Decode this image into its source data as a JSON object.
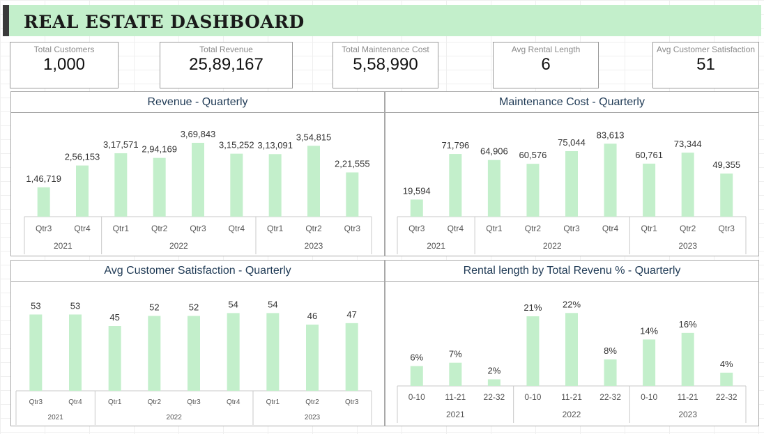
{
  "title": "REAL ESTATE DASHBOARD",
  "colors": {
    "bar": "#c3efcb",
    "title_bg": "#c3efcb",
    "axis": "#c8c8c8"
  },
  "kpis": [
    {
      "label": "Total Customers",
      "value": "1,000"
    },
    {
      "label": "Total Revenue",
      "value": "25,89,167"
    },
    {
      "label": "Total Maintenance Cost",
      "value": "5,58,990"
    },
    {
      "label": "Avg Rental Length",
      "value": "6"
    },
    {
      "label": "Avg Customer Satisfaction",
      "value": "51"
    }
  ],
  "chart_data": [
    {
      "type": "bar",
      "title": "Revenue - Quarterly",
      "categories": [
        "Qtr3",
        "Qtr4",
        "Qtr1",
        "Qtr2",
        "Qtr3",
        "Qtr4",
        "Qtr1",
        "Qtr2",
        "Qtr3"
      ],
      "groups": [
        {
          "label": "2021",
          "count": 2
        },
        {
          "label": "2022",
          "count": 4
        },
        {
          "label": "2023",
          "count": 3
        }
      ],
      "values": [
        146719,
        256153,
        317571,
        294169,
        369843,
        315252,
        313091,
        354815,
        221555
      ],
      "data_labels": [
        "1,46,719",
        "2,56,153",
        "3,17,571",
        "2,94,169",
        "3,69,843",
        "3,15,252",
        "3,13,091",
        "3,54,815",
        "2,21,555"
      ],
      "ylim": [
        0,
        450000
      ],
      "grid": false
    },
    {
      "type": "bar",
      "title": "Maintenance Cost - Quarterly",
      "categories": [
        "Qtr3",
        "Qtr4",
        "Qtr1",
        "Qtr2",
        "Qtr3",
        "Qtr4",
        "Qtr1",
        "Qtr2",
        "Qtr3"
      ],
      "groups": [
        {
          "label": "2021",
          "count": 2
        },
        {
          "label": "2022",
          "count": 4
        },
        {
          "label": "2023",
          "count": 3
        }
      ],
      "values": [
        19594,
        71796,
        64906,
        60576,
        75044,
        83613,
        60761,
        73344,
        49355
      ],
      "data_labels": [
        "19,594",
        "71,796",
        "64,906",
        "60,576",
        "75,044",
        "83,613",
        "60,761",
        "73,344",
        "49,355"
      ],
      "ylim": [
        0,
        95000
      ],
      "grid": false
    },
    {
      "type": "bar",
      "title": "Avg Customer Satisfaction - Quarterly",
      "categories": [
        "Qtr3",
        "Qtr4",
        "Qtr1",
        "Qtr2",
        "Qtr3",
        "Qtr4",
        "Qtr1",
        "Qtr2",
        "Qtr3"
      ],
      "groups": [
        {
          "label": "2021",
          "count": 2
        },
        {
          "label": "2022",
          "count": 4
        },
        {
          "label": "2023",
          "count": 3
        }
      ],
      "values": [
        53,
        53,
        45,
        52,
        52,
        54,
        54,
        46,
        47
      ],
      "data_labels": [
        "53",
        "53",
        "45",
        "52",
        "52",
        "54",
        "54",
        "46",
        "47"
      ],
      "ylim": [
        0,
        60
      ],
      "grid": false
    },
    {
      "type": "bar",
      "title": "Rental length by Total Revenu % - Quarterly",
      "categories": [
        "0-10",
        "11-21",
        "22-32",
        "0-10",
        "11-21",
        "22-32",
        "0-10",
        "11-21",
        "22-32"
      ],
      "groups": [
        {
          "label": "2021",
          "count": 3
        },
        {
          "label": "2022",
          "count": 3
        },
        {
          "label": "2023",
          "count": 3
        }
      ],
      "values": [
        6,
        7,
        2,
        21,
        22,
        8,
        14,
        16,
        4
      ],
      "data_labels": [
        "6%",
        "7%",
        "2%",
        "21%",
        "22%",
        "8%",
        "14%",
        "16%",
        "4%"
      ],
      "ylim": [
        0,
        25
      ],
      "grid": false
    }
  ]
}
